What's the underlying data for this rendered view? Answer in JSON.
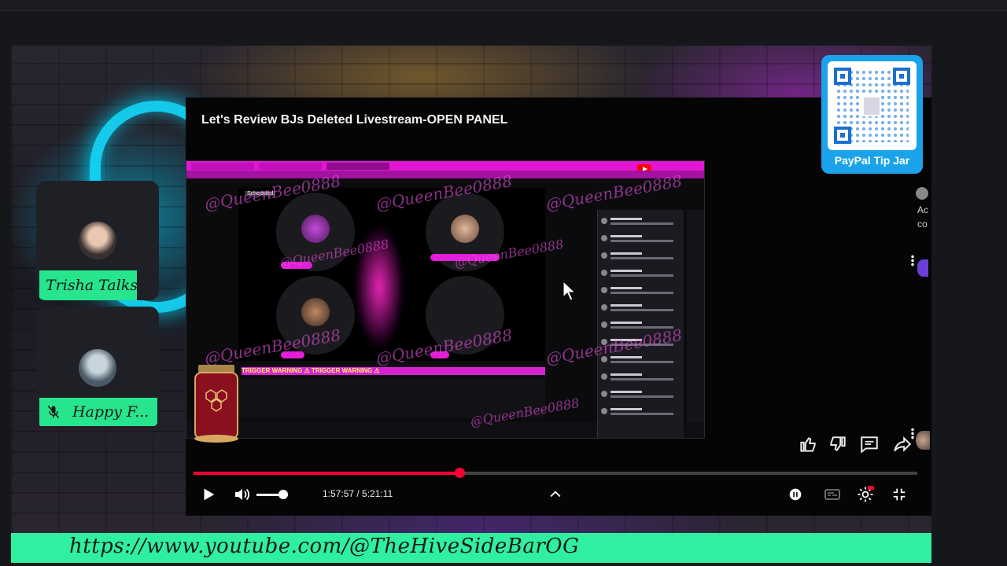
{
  "video": {
    "title": "Let's Review BJs Deleted Livestream-OPEN PANEL",
    "current_time": "1:57:57",
    "duration": "5:21:11",
    "time_display": "1:57:57 / 5:21:11",
    "progress": 0.367,
    "volume": 0.85
  },
  "capture": {
    "watermark": "@QueenBee0888",
    "warning_text": "TRIGGER WARNING ⚠ TRIGGER WARNING ⚠",
    "status_badge": "Scheduled"
  },
  "actions": {
    "like_icon": "thumbs-up-icon",
    "dislike_icon": "thumbs-down-icon",
    "comments_icon": "comment-icon",
    "share_icon": "share-icon"
  },
  "controls": {
    "play_icon": "play-icon",
    "volume_icon": "volume-icon",
    "chevron_icon": "chevron-up-icon",
    "settings_icon": "settings-icon",
    "captions_icon": "captions-icon",
    "exit_fullscreen_icon": "exit-fullscreen-icon"
  },
  "cameras": [
    {
      "name": "Trisha Talks",
      "muted": false
    },
    {
      "name": "Happy F...",
      "muted": true
    }
  ],
  "paypal": {
    "label": "PayPal Tip Jar"
  },
  "edge": {
    "text1": "Ac",
    "text2": "co"
  },
  "banner": {
    "url": "https://www.youtube.com/@TheHiveSideBarOG"
  },
  "colors": {
    "accent_green": "#2ff0a0",
    "youtube_red": "#ff0033",
    "paypal_blue": "#1aa3ea",
    "stream_pink": "#e316d4"
  }
}
